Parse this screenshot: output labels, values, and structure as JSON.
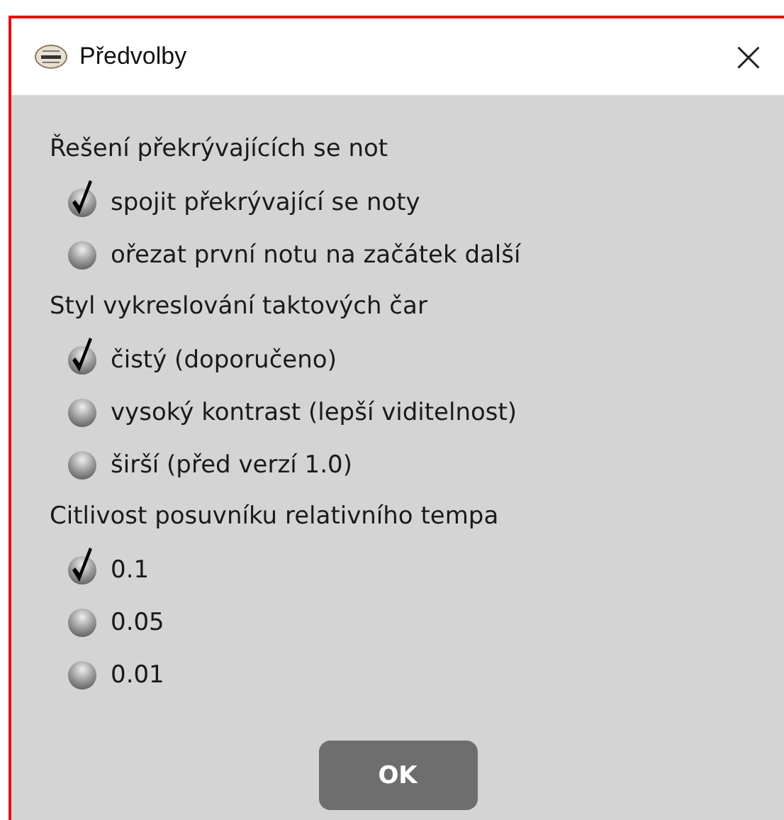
{
  "window": {
    "title": "Předvolby",
    "close": "×"
  },
  "groups": [
    {
      "label": "Řešení překrývajících se not",
      "options": [
        {
          "label": "spojit překrývající se noty",
          "selected": true
        },
        {
          "label": "ořezat první notu na začátek další",
          "selected": false
        }
      ]
    },
    {
      "label": "Styl vykreslování taktových čar",
      "options": [
        {
          "label": "čistý (doporučeno)",
          "selected": true
        },
        {
          "label": "vysoký kontrast (lepší viditelnost)",
          "selected": false
        },
        {
          "label": "širší (před verzí 1.0)",
          "selected": false
        }
      ]
    },
    {
      "label": "Citlivost posuvníku relativního tempa",
      "options": [
        {
          "label": "0.1",
          "selected": true
        },
        {
          "label": "0.05",
          "selected": false
        },
        {
          "label": "0.01",
          "selected": false
        }
      ]
    }
  ],
  "buttons": [
    "OK"
  ]
}
